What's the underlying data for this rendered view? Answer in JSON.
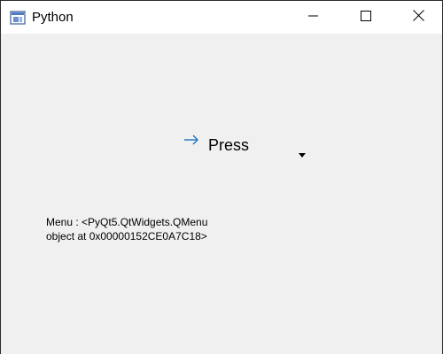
{
  "window": {
    "title": "Python",
    "title_icon": "python-app-icon",
    "controls": {
      "minimize_icon": "minimize-icon",
      "maximize_icon": "maximize-icon",
      "close_icon": "close-icon"
    }
  },
  "main": {
    "button": {
      "label": "Press",
      "icon": "arrow-right-icon",
      "menu_indicator_icon": "dropdown-caret-icon"
    },
    "menu_label": {
      "line1": "Menu : <PyQt5.QtWidgets.QMenu",
      "line2": "object at 0x00000152CE0A7C18>"
    }
  },
  "colors": {
    "window_background": "#f0f0f0",
    "titlebar_background": "#ffffff",
    "arrow_accent": "#1e73be",
    "text": "#000000"
  }
}
